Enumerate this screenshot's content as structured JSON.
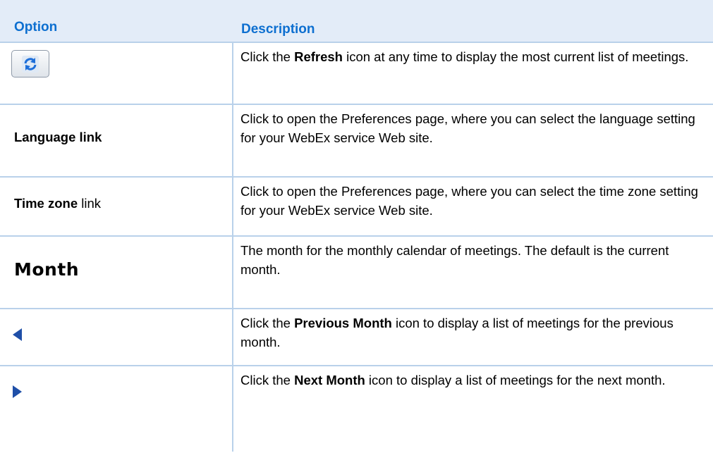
{
  "header": {
    "option": "Option",
    "description": "Description"
  },
  "rows": [
    {
      "option_icon": "refresh-icon",
      "desc": {
        "pre": "Click the ",
        "bold": "Refresh",
        "post": " icon at any time to display the most current list of meetings."
      }
    },
    {
      "option_label": "Language link",
      "desc": {
        "text": "Click to open the Preferences page, where you can select the language setting for your WebEx service Web site."
      }
    },
    {
      "option_bold": "Time zone",
      "option_rest": " link",
      "desc": {
        "text": "Click to open the Preferences page, where you can select the time zone setting for your WebEx service Web site."
      }
    },
    {
      "option_label": "Month",
      "desc": {
        "text": "The month for the monthly calendar of meetings. The default is the current month."
      }
    },
    {
      "option_icon": "previous-month-icon",
      "desc": {
        "pre": "Click the ",
        "bold": "Previous Month",
        "post": " icon to display a list of meetings for the previous month."
      }
    },
    {
      "option_icon": "next-month-icon",
      "desc": {
        "pre": "Click the ",
        "bold": "Next Month",
        "post": " icon to display a list of meetings for the next month."
      }
    }
  ],
  "colors": {
    "header_bg": "#e3ecf8",
    "header_text": "#0d6fd0",
    "rule": "#b9d1ea",
    "arrow": "#1f4fa8"
  }
}
